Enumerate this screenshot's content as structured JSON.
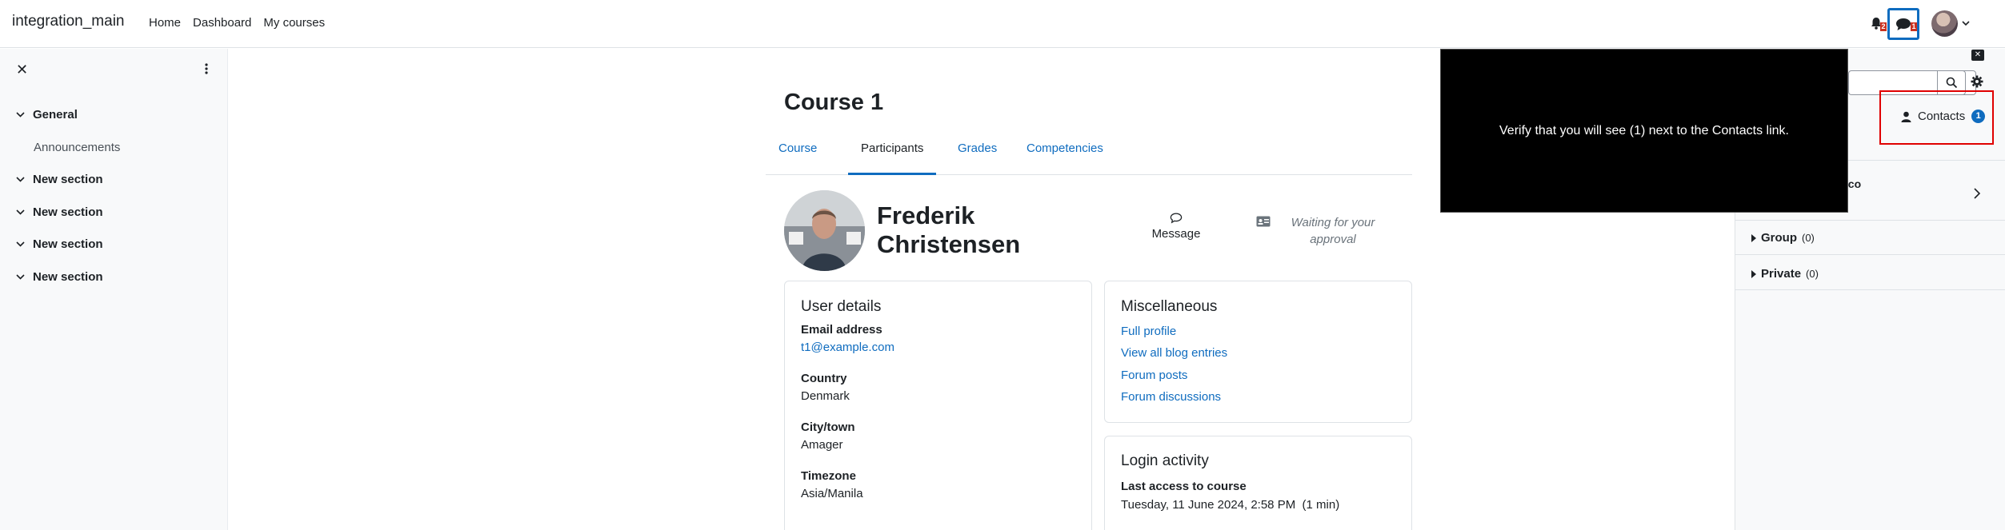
{
  "navbar": {
    "brand": "integration_main",
    "links": [
      "Home",
      "Dashboard",
      "My courses"
    ],
    "notif_count": "2",
    "message_count": "1"
  },
  "drawer": {
    "sections": [
      {
        "label": "General"
      },
      {
        "label": "New section"
      },
      {
        "label": "New section"
      },
      {
        "label": "New section"
      },
      {
        "label": "New section"
      }
    ],
    "subitem": "Announcements"
  },
  "course": {
    "title": "Course 1",
    "tabs": [
      "Course",
      "Participants",
      "Grades",
      "Competencies"
    ],
    "active_tab": "Participants"
  },
  "profile": {
    "name_line1": "Frederik",
    "name_line2": "Christensen",
    "message_label": "Message",
    "approval_label": "Waiting for your approval"
  },
  "user_details": {
    "title": "User details",
    "fields": [
      {
        "label": "Email address",
        "value": "t1@example.com"
      },
      {
        "label": "Country",
        "value": "Denmark"
      },
      {
        "label": "City/town",
        "value": "Amager"
      },
      {
        "label": "Timezone",
        "value": "Asia/Manila"
      }
    ]
  },
  "misc": {
    "title": "Miscellaneous",
    "links": [
      "Full profile",
      "View all blog entries",
      "Forum posts",
      "Forum discussions"
    ]
  },
  "login_activity": {
    "title": "Login activity",
    "label": "Last access to course",
    "value": "Tuesday, 11 June 2024, 2:58 PM  (1 min)"
  },
  "messaging": {
    "contacts_label": "Contacts",
    "contacts_count": "1",
    "partial_name": "sco",
    "group_label": "Group",
    "group_count": "(0)",
    "private_label": "Private",
    "private_count": "(0)"
  },
  "overlay": {
    "text": "Verify that you will see (1) next to the Contacts link."
  },
  "colors": {
    "accent": "#0f6cbf",
    "badge_red": "#ca3120",
    "highlight_red": "#e00000"
  }
}
